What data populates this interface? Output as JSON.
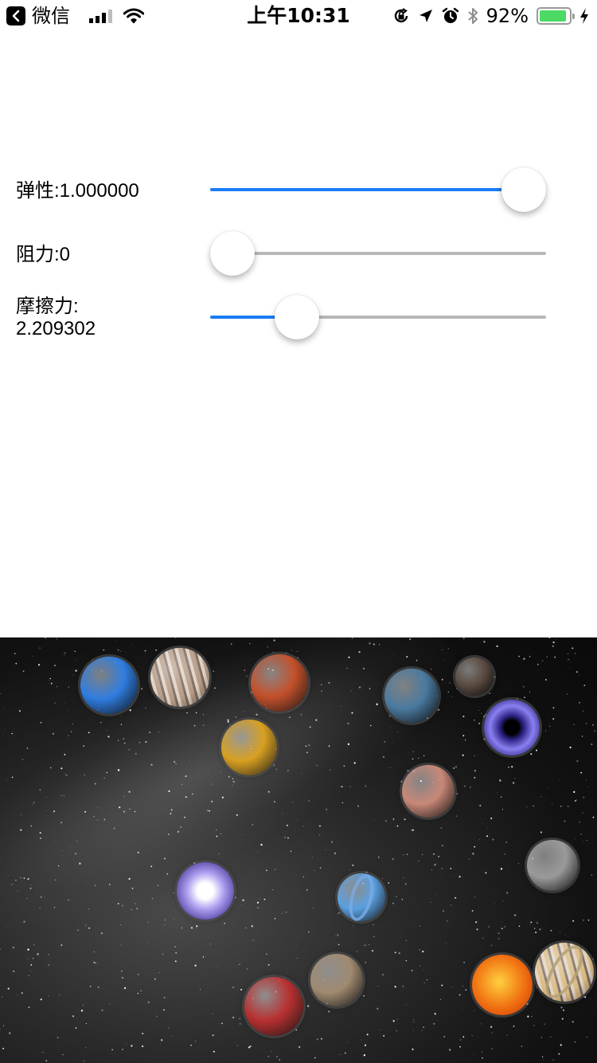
{
  "status_bar": {
    "back_app": "微信",
    "time": "上午10:31",
    "battery_percent": "92%",
    "battery_level": 0.92,
    "signal_bars": 3
  },
  "controls": [
    {
      "label": "弹性:1.000000",
      "value_fraction": 1.0
    },
    {
      "label": "阻力:0",
      "value_fraction": 0.0
    },
    {
      "label": "摩擦力:\n2.209302",
      "value_fraction": 0.22
    }
  ],
  "planets": [
    {
      "name": "neptune",
      "color": "#2f7de0"
    },
    {
      "name": "jupiter",
      "color": "#b49a86"
    },
    {
      "name": "mars",
      "color": "#c3502a"
    },
    {
      "name": "venus",
      "color": "#d8a020"
    },
    {
      "name": "earth",
      "color": "#4a7aa0"
    },
    {
      "name": "asteroid",
      "color": "#5a4a40"
    },
    {
      "name": "black-hole",
      "color": "#4a40c0"
    },
    {
      "name": "pink-planet",
      "color": "#c88878"
    },
    {
      "name": "moon",
      "color": "#9a9a9a"
    },
    {
      "name": "nebula-planet",
      "color": "#9a88d8"
    },
    {
      "name": "uranus",
      "color": "#5aa0e0"
    },
    {
      "name": "mercury",
      "color": "#a08a70"
    },
    {
      "name": "lava-planet",
      "color": "#b83030"
    },
    {
      "name": "sun",
      "color": "#f07010"
    },
    {
      "name": "saturn",
      "color": "#d8b880"
    }
  ]
}
